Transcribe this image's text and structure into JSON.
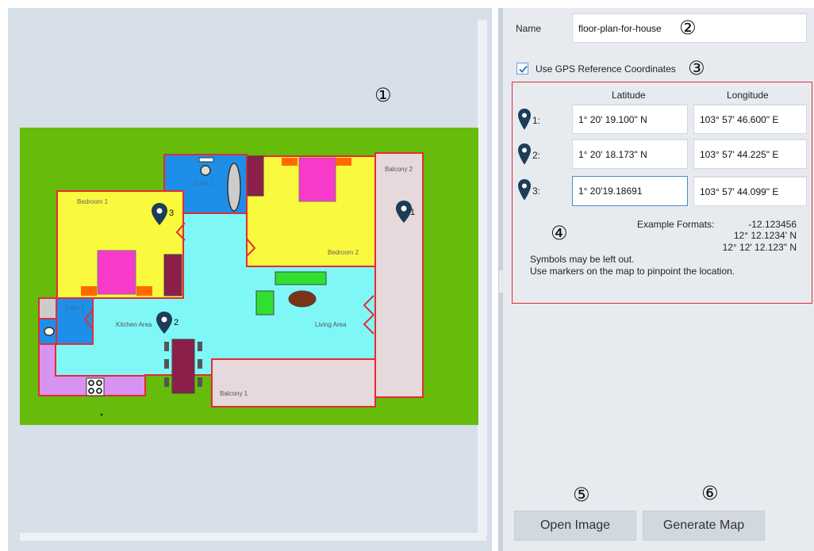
{
  "callouts": {
    "c1": "①",
    "c2": "②",
    "c3": "③",
    "c4": "④",
    "c5": "⑤",
    "c6": "⑥"
  },
  "floor_plan": {
    "rooms": {
      "bedroom1": "Bedroom 1",
      "bedroom2": "Bedroom 2",
      "toilet1": "Toilet 1",
      "toilet2": "Toilet 2",
      "kitchen": "Kitchen Area",
      "living": "Living Area",
      "balcony1": "Balcony 1",
      "balcony2": "Balcony 2"
    },
    "markers": [
      "1",
      "2",
      "3"
    ]
  },
  "form": {
    "name_label": "Name",
    "name_value": "floor-plan-for-house",
    "gps_checkbox_label": "Use GPS Reference Coordinates",
    "gps_checked": true,
    "col_latitude": "Latitude",
    "col_longitude": "Longitude",
    "rows": [
      {
        "label": "1:",
        "lat": "1° 20' 19.100\" N",
        "lon": "103° 57' 46.600\" E"
      },
      {
        "label": "2:",
        "lat": "1° 20' 18.173\" N",
        "lon": "103° 57' 44.225\" E"
      },
      {
        "label": "3:",
        "lat": "1° 20'19.18691",
        "lon": "103° 57' 44.099\" E"
      }
    ],
    "example_label": "Example Formats:",
    "examples": [
      "-12.123456",
      "12° 12.1234' N",
      "12° 12' 12.123\" N"
    ],
    "hint1": "Symbols may be left out.",
    "hint2": "Use markers on the map to pinpoint the location."
  },
  "buttons": {
    "open_image": "Open Image",
    "generate_map": "Generate Map"
  },
  "colors": {
    "grass": "#66bb0b",
    "wall": "#e52a36",
    "bedroom": "#f9f93d",
    "water": "#80f7f7",
    "toilet": "#1d8fe8",
    "balcony": "#e5d9dc",
    "bed": "#f73ac9",
    "accent": "#e52a36",
    "marker": "#1d3c57"
  }
}
